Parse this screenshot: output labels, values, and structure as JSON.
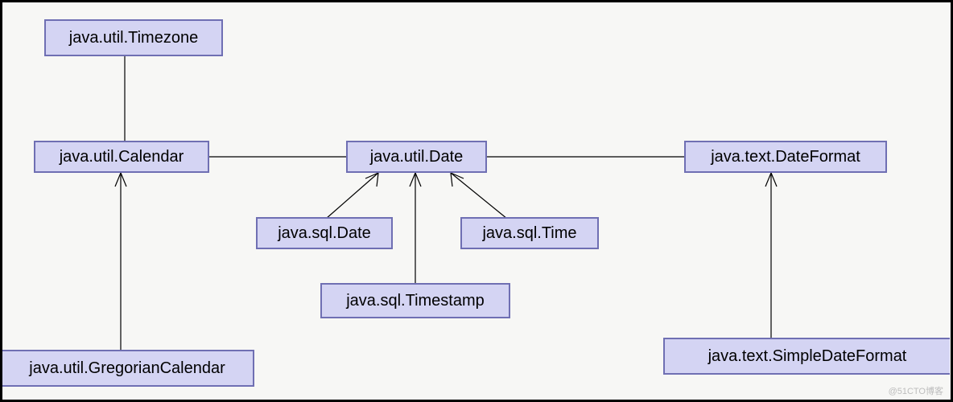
{
  "diagram": {
    "nodes": {
      "timezone": {
        "label": "java.util.Timezone"
      },
      "calendar": {
        "label": "java.util.Calendar"
      },
      "utilDate": {
        "label": "java.util.Date"
      },
      "dateFormat": {
        "label": "java.text.DateFormat"
      },
      "sqlDate": {
        "label": "java.sql.Date"
      },
      "sqlTime": {
        "label": "java.sql.Time"
      },
      "sqlTimestamp": {
        "label": "java.sql.Timestamp"
      },
      "gregCalendar": {
        "label": "java.util.GregorianCalendar"
      },
      "simpleDateFmt": {
        "label": "java.text.SimpleDateFormat"
      }
    },
    "colors": {
      "nodeFill": "#d4d4f3",
      "nodeBorder": "#6f6fb3",
      "line": "#000000",
      "canvasBg": "#f7f7f5"
    },
    "edges": [
      {
        "from": "timezone",
        "to": "calendar",
        "style": "line"
      },
      {
        "from": "calendar",
        "to": "utilDate",
        "style": "line"
      },
      {
        "from": "utilDate",
        "to": "dateFormat",
        "style": "line"
      },
      {
        "from": "gregCalendar",
        "to": "calendar",
        "style": "arrow"
      },
      {
        "from": "sqlDate",
        "to": "utilDate",
        "style": "arrow"
      },
      {
        "from": "sqlTime",
        "to": "utilDate",
        "style": "arrow"
      },
      {
        "from": "sqlTimestamp",
        "to": "utilDate",
        "style": "arrow"
      },
      {
        "from": "simpleDateFmt",
        "to": "dateFormat",
        "style": "arrow"
      }
    ],
    "watermark": "@51CTO博客"
  }
}
